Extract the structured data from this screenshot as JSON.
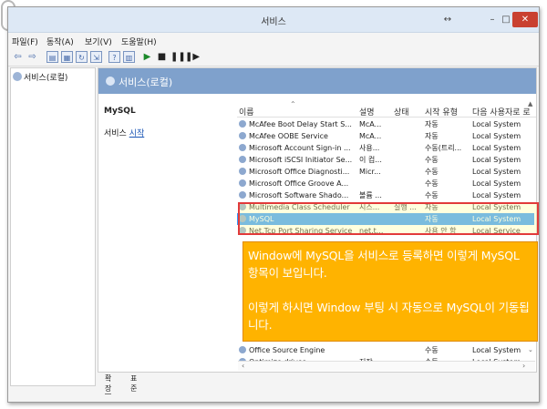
{
  "window": {
    "title": "서비스",
    "controls": {
      "restore": "↔",
      "minimize": "–",
      "maximize": "□",
      "close": "✕"
    }
  },
  "menu": [
    "파일(F)",
    "동작(A)",
    "보기(V)",
    "도움말(H)"
  ],
  "toolbar": {
    "icons": [
      "back-arrow-icon",
      "forward-arrow-icon",
      "console-tree-icon",
      "properties-icon",
      "refresh-icon",
      "export-list-icon",
      "help-icon",
      "show-hide-icon",
      "start-service-icon",
      "stop-service-icon",
      "pause-service-icon",
      "restart-service-icon"
    ]
  },
  "tree": {
    "root_label": "서비스(로컬)"
  },
  "main": {
    "header_title": "서비스(로컬)",
    "detail_title": "MySQL",
    "detail_prefix": "서비스 ",
    "detail_link": "시작"
  },
  "table": {
    "columns": [
      "이름",
      "설명",
      "상태",
      "시작 유형",
      "다음 사용자로 로"
    ],
    "rows": [
      {
        "name": "McAfee Boot Delay Start S...",
        "desc": "McA...",
        "status": "",
        "start": "자동",
        "logon": "Local System"
      },
      {
        "name": "McAfee OOBE Service",
        "desc": "McA...",
        "status": "",
        "start": "자동",
        "logon": "Local System"
      },
      {
        "name": "Microsoft Account Sign-in ...",
        "desc": "사용...",
        "status": "",
        "start": "수동(트리...",
        "logon": "Local System"
      },
      {
        "name": "Microsoft iSCSI Initiator Se...",
        "desc": "이 컴...",
        "status": "",
        "start": "수동",
        "logon": "Local System"
      },
      {
        "name": "Microsoft Office Diagnosti...",
        "desc": "Micr...",
        "status": "",
        "start": "수동",
        "logon": "Local System"
      },
      {
        "name": "Microsoft Office Groove A...",
        "desc": "",
        "status": "",
        "start": "수동",
        "logon": "Local System"
      },
      {
        "name": "Microsoft Software Shado...",
        "desc": "볼륨 ...",
        "status": "",
        "start": "수동",
        "logon": "Local System"
      },
      {
        "name": "Multimedia Class Scheduler",
        "desc": "시스...",
        "status": "실행 ...",
        "start": "자동",
        "logon": "Local System"
      },
      {
        "name": "MySQL",
        "desc": "",
        "status": "",
        "start": "자동",
        "logon": "Local System"
      },
      {
        "name": "Net.Tcp Port Sharing Service",
        "desc": "net.t...",
        "status": "",
        "start": "사용 안 함",
        "logon": "Local Service"
      },
      {
        "name": "Office Source Engine",
        "desc": "",
        "status": "",
        "start": "수동",
        "logon": "Local System"
      },
      {
        "name": "Optimize drives",
        "desc": "저장...",
        "status": "",
        "start": "수동",
        "logon": "Local System"
      }
    ]
  },
  "note": {
    "line1": "Window에 MySQL을 서비스로 등록하면 이렇게 MySQL 항목이 보입니다.",
    "line2": "이렇게 하시면 Window 부팅 시 자동으로 MySQL이 기동됩니다."
  },
  "tabs": {
    "extended": "확장",
    "standard": "표준"
  },
  "colors": {
    "header_blue": "#7fa1cc",
    "selection": "#3399ff",
    "note_orange": "#ffb300",
    "highlight_red": "#e23a3a"
  }
}
